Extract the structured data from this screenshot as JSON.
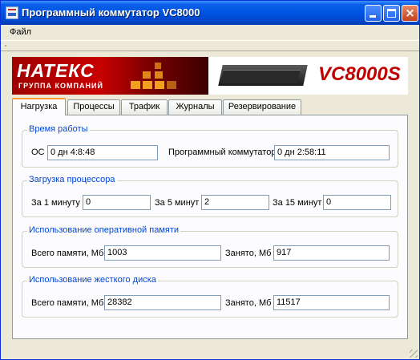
{
  "window": {
    "title": "Программный коммутатор VC8000"
  },
  "menu": {
    "file": "Файл"
  },
  "banner": {
    "brand": "НАТЕКС",
    "brand_sub": "ГРУППА КОМПАНИЙ",
    "model": "VC8000S",
    "colors": {
      "brand_red": "#c80000",
      "accent_orange": "#f0a020"
    }
  },
  "tabs": [
    {
      "label": "Нагрузка",
      "active": true
    },
    {
      "label": "Процессы",
      "active": false
    },
    {
      "label": "Трафик",
      "active": false
    },
    {
      "label": "Журналы",
      "active": false
    },
    {
      "label": "Резервирование",
      "active": false
    }
  ],
  "uptime": {
    "legend": "Время работы",
    "os_label": "ОС",
    "os_value": "0 дн 4:8:48",
    "switch_label": "Программный коммутатор",
    "switch_value": "0 дн 2:58:11"
  },
  "cpu": {
    "legend": "Загрузка процессора",
    "m1_label": "За 1 минуту",
    "m1_value": "0",
    "m5_label": "За 5 минут",
    "m5_value": "2",
    "m15_label": "За 15 минут",
    "m15_value": "0"
  },
  "ram": {
    "legend": "Использование оперативной памяти",
    "total_label": "Всего памяти, Мб",
    "total_value": "1003",
    "used_label": "Занято, Мб",
    "used_value": "917"
  },
  "disk": {
    "legend": "Использование жесткого диска",
    "total_label": "Всего памяти, Мб",
    "total_value": "28382",
    "used_label": "Занято, Мб",
    "used_value": "11517"
  }
}
